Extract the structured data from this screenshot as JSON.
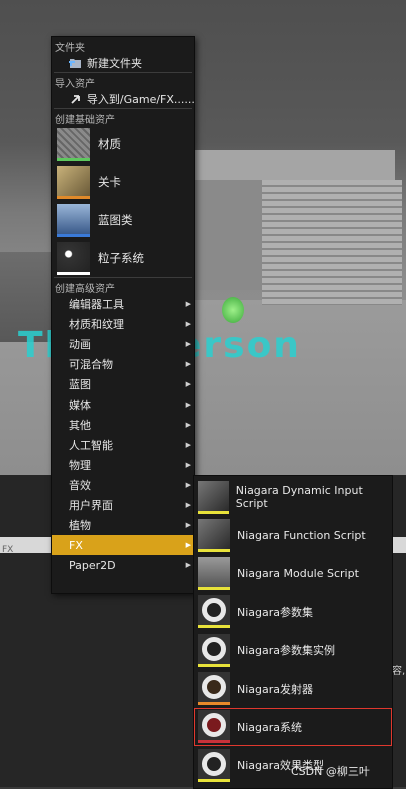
{
  "viewport": {
    "text": "Third Person"
  },
  "bottom": {
    "strip_label": "FX",
    "cut_text": "容,"
  },
  "menu": {
    "sections": {
      "folder": "文件夹",
      "import": "导入资产",
      "basic": "创建基础资产",
      "advanced": "创建高级资产"
    },
    "new_folder": "新建文件夹",
    "import_to": "导入到/Game/FX......",
    "basic_assets": [
      {
        "label": "材质",
        "color": "#5ec85e",
        "icon": "material-sphere-icon"
      },
      {
        "label": "关卡",
        "color": "#e08a2a",
        "icon": "level-icon"
      },
      {
        "label": "蓝图类",
        "color": "#3a7ad8",
        "icon": "blueprint-icon"
      },
      {
        "label": "粒子系统",
        "color": "#ffffff",
        "icon": "particle-icon"
      }
    ],
    "advanced_items": [
      "编辑器工具",
      "材质和纹理",
      "动画",
      "可混合物",
      "蓝图",
      "媒体",
      "其他",
      "人工智能",
      "物理",
      "音效",
      "用户界面",
      "植物",
      "FX",
      "Paper2D"
    ],
    "selected_index": 12
  },
  "submenu": {
    "items": [
      {
        "label": "Niagara Dynamic Input Script",
        "color": "#e8e23a"
      },
      {
        "label": "Niagara Function Script",
        "color": "#e8e23a"
      },
      {
        "label": "Niagara Module Script",
        "color": "#e8e23a"
      },
      {
        "label": "Niagara参数集",
        "color": "#e8e23a"
      },
      {
        "label": "Niagara参数集实例",
        "color": "#e8e23a"
      },
      {
        "label": "Niagara发射器",
        "color": "#e88a2a"
      },
      {
        "label": "Niagara系统",
        "color": "#c8323a"
      },
      {
        "label": "Niagara效果类型",
        "color": "#e8e23a"
      }
    ],
    "highlight_index": 6
  },
  "watermark": "CSDN @柳三叶"
}
